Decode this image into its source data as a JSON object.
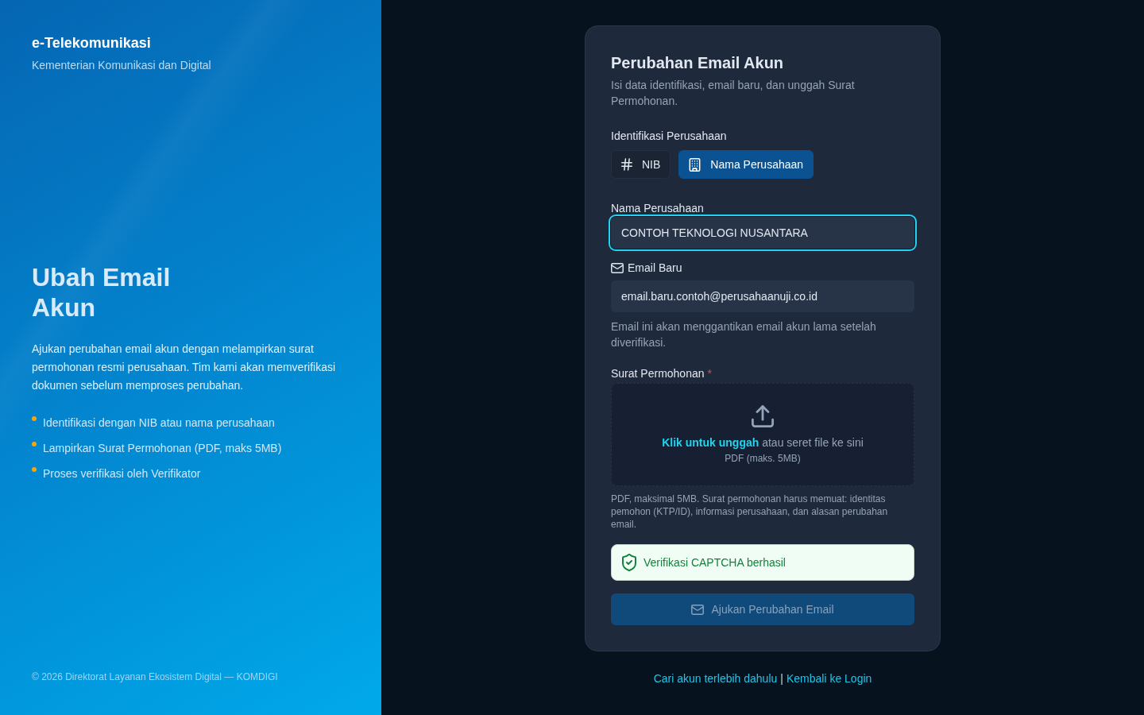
{
  "sidebar": {
    "brand": {
      "title": "e-Telekomunikasi",
      "subtitle": "Kementerian Komunikasi dan Digital"
    },
    "heading": "Ubah Email Akun",
    "description": "Ajukan perubahan email akun dengan melampirkan surat permohonan resmi perusahaan. Tim kami akan memverifikasi dokumen sebelum memproses perubahan.",
    "features": [
      "Identifikasi dengan NIB atau nama perusahaan",
      "Lampirkan Surat Permohonan (PDF, maks 5MB)",
      "Proses verifikasi oleh Verifikator"
    ],
    "footer": "© 2026 Direktorat Layanan Ekosistem Digital — KOMDIGI"
  },
  "form": {
    "title": "Perubahan Email Akun",
    "subtitle": "Isi data identifikasi, email baru, dan unggah Surat Permohonan.",
    "identification": {
      "label": "Identifikasi Perusahaan",
      "options": [
        {
          "kind": "hash",
          "label": "NIB",
          "selected": false
        },
        {
          "kind": "building",
          "label": "Nama Perusahaan",
          "selected": true
        }
      ]
    },
    "fields": [
      {
        "kind": "text",
        "label": "Nama Perusahaan",
        "value": "CONTOH TEKNOLOGI NUSANTARA",
        "focused": true
      },
      {
        "kind": "email",
        "label": "Email Baru",
        "value": "email.baru.contoh@perusahaanuji.co.id",
        "focused": false,
        "help": "Email ini akan menggantikan email akun lama setelah diverifikasi."
      }
    ],
    "upload": {
      "label": "Surat Permohonan",
      "required_mark": "*",
      "link": "Klik untuk unggah",
      "text": "atau seret file ke sini",
      "formats": "PDF (maks. 5MB)",
      "help": "PDF, maksimal 5MB. Surat permohonan harus memuat: identitas pemohon (KTP/ID), informasi perusahaan, dan alasan perubahan email."
    },
    "captcha": {
      "text": "Verifikasi CAPTCHA berhasil",
      "verified": true
    },
    "submit": {
      "label": "Ajukan Perubahan Email",
      "disabled": true
    }
  },
  "footer_links": {
    "items": [
      "Cari akun terlebih dahulu",
      "Kembali ke Login"
    ],
    "separator": "|"
  }
}
